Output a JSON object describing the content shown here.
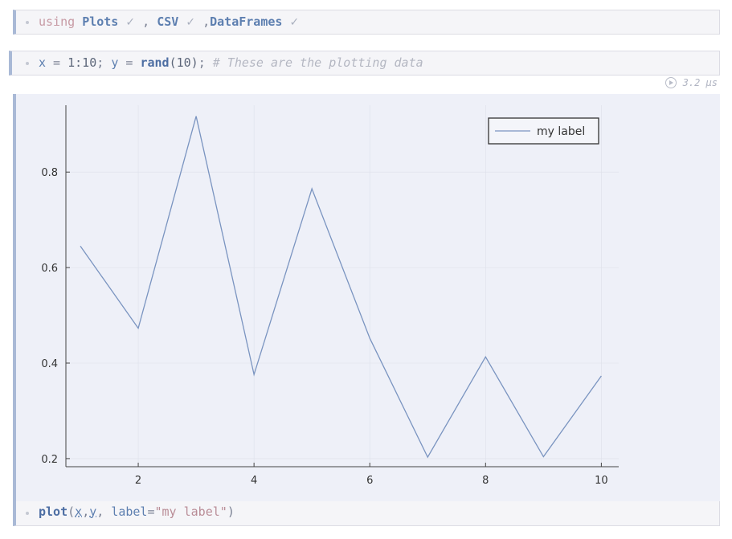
{
  "cells": {
    "imports": {
      "keyword": "using",
      "modules": [
        "Plots",
        "CSV",
        "DataFrames"
      ],
      "check_icon": "check-icon"
    },
    "data_cell": {
      "code_x": "x",
      "code_eq1": " = ",
      "code_range": "1:10",
      "code_sep": "; ",
      "code_y": "y",
      "code_eq2": " = ",
      "code_fn": "rand",
      "code_args": "(10)",
      "code_semi": "; ",
      "comment": "# These are the plotting data"
    },
    "timing": {
      "label": "3.2 μs",
      "icon": "run-icon"
    },
    "plot_cell": {
      "fn": "plot",
      "open": "(",
      "arg1": "x",
      "comma1": ",",
      "arg2": "y",
      "comma2": ", ",
      "kwarg": "label",
      "eq": "=",
      "str": "\"my label\"",
      "close": ")"
    }
  },
  "colors": {
    "line": "#7a94c0",
    "axis": "#444444",
    "grid": "#dde0ea",
    "plot_bg": "#eef0f8",
    "cell_border": "#a9b9d6"
  },
  "chart_data": {
    "type": "line",
    "x": [
      1,
      2,
      3,
      4,
      5,
      6,
      7,
      8,
      9,
      10
    ],
    "series": [
      {
        "name": "my label",
        "values": [
          0.645,
          0.473,
          0.917,
          0.376,
          0.765,
          0.452,
          0.203,
          0.413,
          0.204,
          0.373
        ]
      }
    ],
    "xticks": [
      "2",
      "4",
      "6",
      "8",
      "10"
    ],
    "yticks": [
      "0.2",
      "0.4",
      "0.6",
      "0.8"
    ],
    "xlim": [
      0.75,
      10.3
    ],
    "ylim": [
      0.183,
      0.94
    ],
    "legend": "top-right",
    "grid": true
  }
}
